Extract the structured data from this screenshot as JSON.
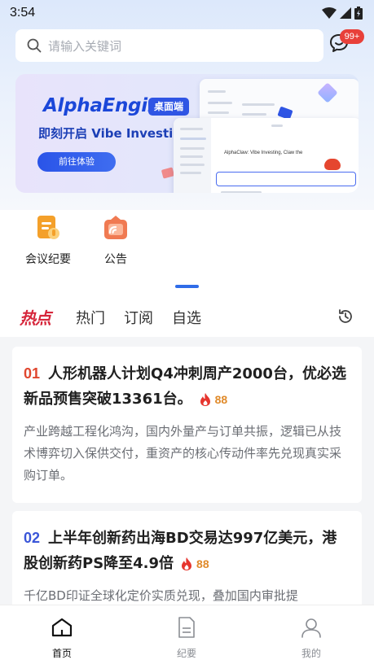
{
  "status_bar": {
    "time": "3:54"
  },
  "search": {
    "placeholder": "请输入关键词"
  },
  "messages": {
    "badge": "99+"
  },
  "banner": {
    "brand": "AlphaEngine",
    "tag": "桌面端",
    "slogan": "即刻开启 Vibe Investing ！",
    "cta": "前往体验",
    "mock_tagline": "AlphaClaw: Vibe Investing, Claw the"
  },
  "shortcuts": [
    {
      "label": "会议纪要",
      "icon": "meeting-notes-icon"
    },
    {
      "label": "公告",
      "icon": "announcement-icon"
    }
  ],
  "tabs": {
    "hot": "热点",
    "popular": "热门",
    "subscribed": "订阅",
    "watchlist": "自选"
  },
  "feed": [
    {
      "rank": "01",
      "rank_color": "#e0472f",
      "title": "人形机器人计划Q4冲刺周产2000台，优必选新品预售突破13361台。",
      "heat": "88",
      "desc": "产业跨越工程化鸿沟，国内外量产与订单共振，逻辑已从技术博弈切入保供交付，重资产的核心传动件率先兑现真实采购订单。"
    },
    {
      "rank": "02",
      "rank_color": "#3a56d8",
      "title": "上半年创新药出海BD交易达997亿美元，港股创新药PS降至4.9倍",
      "heat": "88",
      "desc": "千亿BD印证全球化定价实质兑现，叠加国内审批提"
    }
  ],
  "bottom_nav": [
    {
      "label": "首页",
      "active": true
    },
    {
      "label": "纪要",
      "active": false
    },
    {
      "label": "我的",
      "active": false
    }
  ],
  "colors": {
    "accent": "#2f6ce8",
    "hot_red": "#d6263b",
    "heat_orange": "#e08a2a",
    "badge_red": "#e8403a"
  }
}
